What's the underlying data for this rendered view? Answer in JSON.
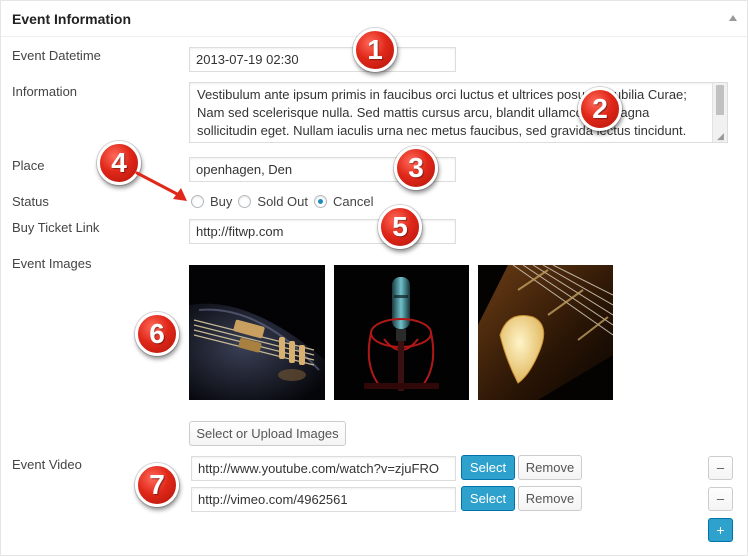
{
  "panel": {
    "title": "Event Information"
  },
  "fields": {
    "datetime": {
      "label": "Event Datetime",
      "value": "2013-07-19 02:30"
    },
    "information": {
      "label": "Information",
      "value": "Vestibulum ante ipsum primis in faucibus orci luctus et ultrices posuere cubilia Curae; Nam sed scelerisque nulla. Sed mattis cursus arcu, blandit ullamcorper magna sollicitudin eget. Nullam iaculis urna nec metus faucibus, sed gravida lectus tincidunt."
    },
    "place": {
      "label": "Place",
      "value": "openhagen, Den"
    },
    "status": {
      "label": "Status",
      "options": [
        "Buy",
        "Sold Out",
        "Cancel"
      ],
      "selected": "Cancel"
    },
    "ticket_link": {
      "label": "Buy Ticket Link",
      "value": "http://fitwp.com"
    },
    "images": {
      "label": "Event Images",
      "upload_button": "Select or Upload Images"
    },
    "video": {
      "label": "Event Video",
      "entries": [
        {
          "url": "http://www.youtube.com/watch?v=zjuFRO",
          "select": "Select",
          "remove": "Remove",
          "minus": "–"
        },
        {
          "url": "http://vimeo.com/4962561",
          "select": "Select",
          "remove": "Remove",
          "minus": "–"
        }
      ],
      "add": "+"
    }
  },
  "badges": [
    "1",
    "2",
    "3",
    "4",
    "5",
    "6",
    "7"
  ],
  "colors": {
    "badge": "#e0281a",
    "primary": "#2ea2cc",
    "radio_checked": "#1e8cbe"
  },
  "icons": {
    "collapse": "triangle-up-icon"
  }
}
